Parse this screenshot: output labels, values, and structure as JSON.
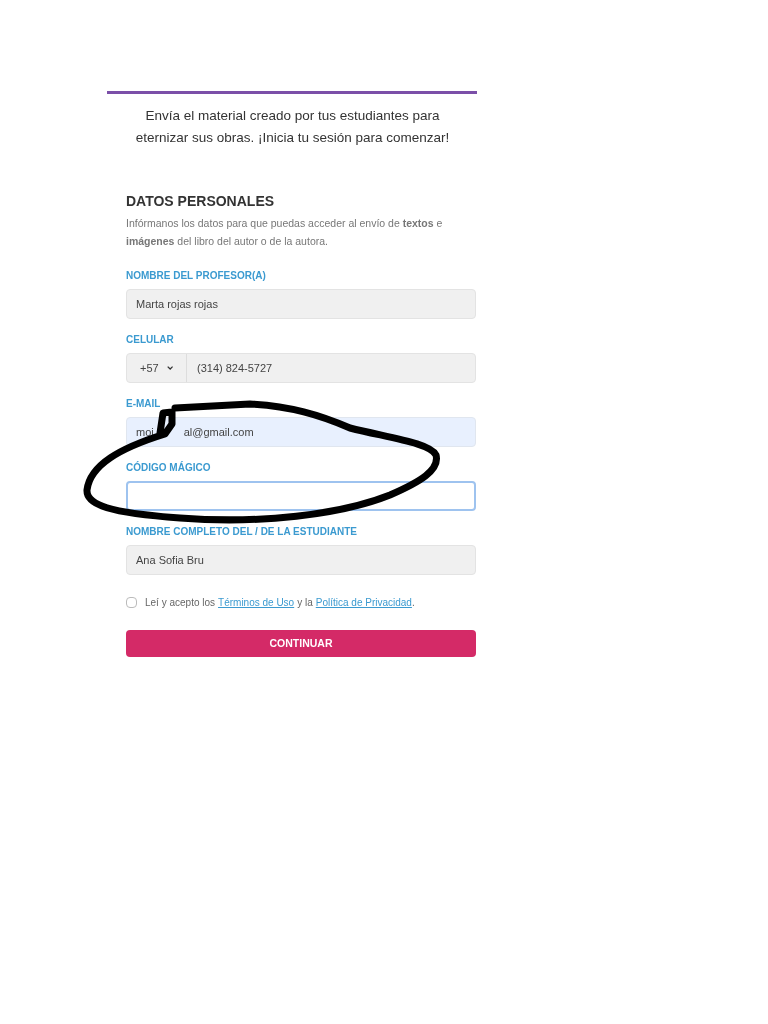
{
  "intro": "Envía el material creado por tus estudiantes para eternizar sus obras. ¡Inicia tu sesión para comenzar!",
  "section": {
    "title": "DATOS PERSONALES",
    "description": "Infórmanos los datos para que puedas acceder al envío de **textos** e **imágenes** del libro del autor o de la autora."
  },
  "fields": [
    {
      "kind": "text",
      "label": "NOMBRE DEL PROFESOR(A)",
      "value": "Marta rojas rojas",
      "focused": false
    },
    {
      "kind": "phone",
      "label": "CELULAR",
      "country_code": "+57",
      "value": "(314) 824-5727",
      "focused": false
    },
    {
      "kind": "partly_covered",
      "label": "E-MAIL",
      "visible_parts": [
        "moi",
        "al@gmail.com"
      ],
      "focused": false
    },
    {
      "kind": "text",
      "label": "CÓDIGO MÁGICO",
      "focused": true
    },
    {
      "kind": "text",
      "label": "NOMBRE COMPLETO DEL / DE LA ESTUDIANTE",
      "value": "Ana Sofia Bru",
      "focused": false
    }
  ],
  "consent": {
    "checked": false,
    "before": "Leí y acepto los",
    "link1": "Términos de Uso",
    "middle": "y la",
    "link2": "Política de Privacidad",
    "after": "."
  },
  "submit": "CONTINUAR"
}
